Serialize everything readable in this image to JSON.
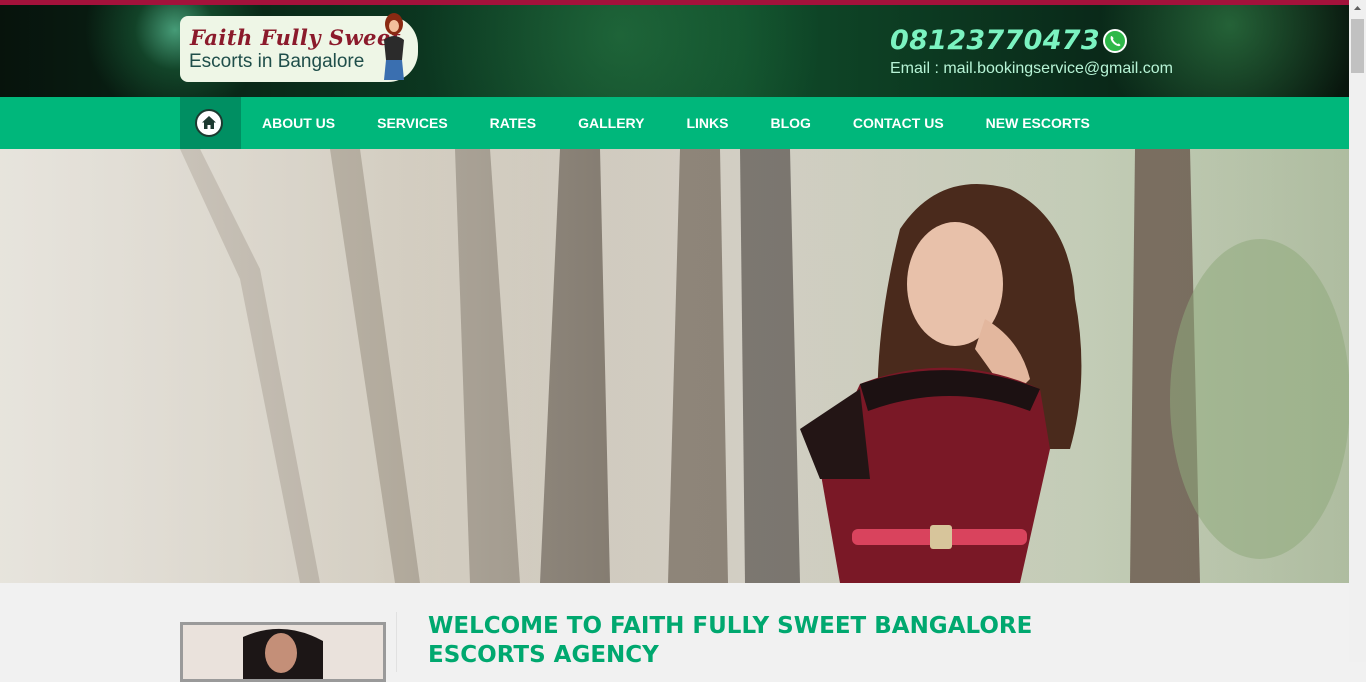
{
  "header": {
    "logo": {
      "line1": "Faith Fully Sweet",
      "line2": "Escorts in Bangalore"
    },
    "phone": "08123770473",
    "email": "Email : mail.bookingservice@gmail.com",
    "phone_icon": "whatsapp-icon"
  },
  "nav": {
    "home_icon": "home-icon",
    "items": [
      {
        "label": "ABOUT US"
      },
      {
        "label": "SERVICES"
      },
      {
        "label": "RATES"
      },
      {
        "label": "GALLERY"
      },
      {
        "label": "LINKS"
      },
      {
        "label": "BLOG"
      },
      {
        "label": "CONTACT US"
      },
      {
        "label": "NEW ESCORTS"
      }
    ]
  },
  "main": {
    "welcome_title": "WELCOME TO FAITH FULLY SWEET BANGALORE ESCORTS AGENCY"
  },
  "colors": {
    "accent": "#00b77b",
    "accent_dark": "#008f62",
    "top_line": "#a3123b",
    "heading": "#00a86f"
  }
}
